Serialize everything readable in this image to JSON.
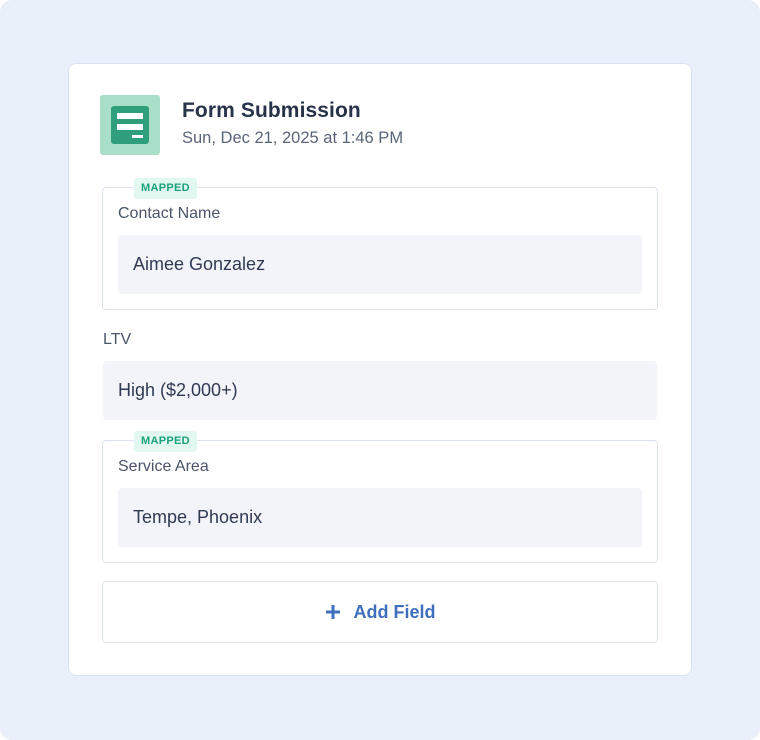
{
  "header": {
    "title": "Form Submission",
    "timestamp": "Sun, Dec 21, 2025 at 1:46 PM",
    "icon": "form-icon"
  },
  "fields": [
    {
      "badge": "MAPPED",
      "label": "Contact Name",
      "value": "Aimee Gonzalez"
    },
    {
      "badge": "",
      "label": "LTV",
      "value": "High ($2,000+)"
    },
    {
      "badge": "MAPPED",
      "label": "Service Area",
      "value": "Tempe, Phoenix"
    }
  ],
  "actions": {
    "add_field_label": "Add Field",
    "add_field_icon": "plus-icon"
  },
  "colors": {
    "background": "#e9f0f9",
    "icon_bg": "#a9dfc8",
    "icon_fg": "#2f9e7a",
    "badge_bg": "#e2f7ef",
    "badge_text": "#1aa27a",
    "accent": "#3e6fbd"
  }
}
